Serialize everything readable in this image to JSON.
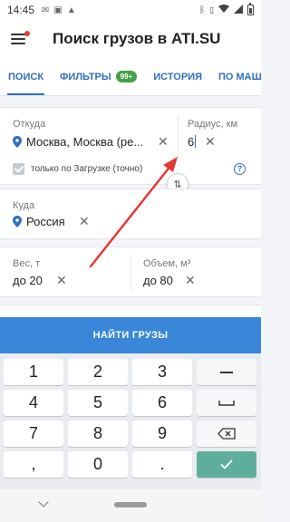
{
  "status_bar": {
    "time": "14:45"
  },
  "header": {
    "title": "Поиск грузов в ATI.SU"
  },
  "tabs": [
    {
      "label": "ПОИСК"
    },
    {
      "label": "ФИЛЬТРЫ",
      "badge": "99+"
    },
    {
      "label": "ИСТОРИЯ"
    },
    {
      "label": "ПО МАШ"
    }
  ],
  "from": {
    "label": "Откуда",
    "value": "Москва, Москва (ре...",
    "radius_label": "Радиус, км",
    "radius_value": "6",
    "checkbox_label": "только по Загрузке (точно)"
  },
  "to": {
    "label": "Куда",
    "value": "Россия"
  },
  "weight": {
    "label": "Вес, т",
    "value": "до 20"
  },
  "volume": {
    "label": "Объем, м³",
    "value": "до 80"
  },
  "search_button": {
    "label": "НАЙТИ ГРУЗЫ"
  },
  "keyboard": {
    "keys": [
      "1",
      "2",
      "3",
      "4",
      "5",
      "6",
      "7",
      "8",
      "9",
      ",",
      "0",
      "."
    ]
  },
  "colors": {
    "accent": "#2f6fbf",
    "primary_button": "#3a86d8",
    "badge": "#43a047",
    "annotation_arrow": "#e53935"
  }
}
